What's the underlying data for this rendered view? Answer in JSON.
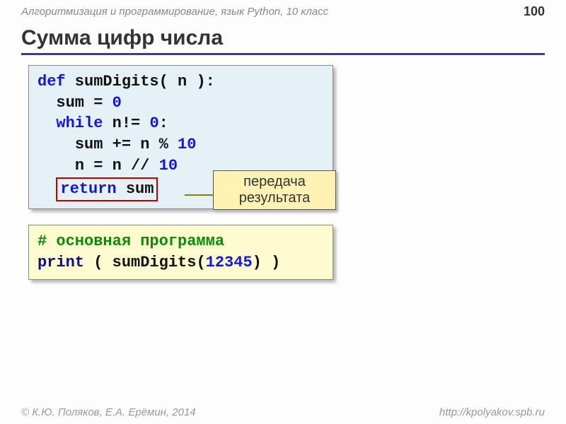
{
  "header": {
    "course": "Алгоритмизация и программирование, язык Python, 10 класс",
    "page_number": "100"
  },
  "title": "Сумма цифр числа",
  "code1": {
    "l1_def": "def",
    "l1_rest": " sumDigits( n ):",
    "l2_a": "sum = ",
    "l2_zero": "0",
    "l3_while": "while",
    "l3_rest": " n!= ",
    "l3_zero": "0",
    "l3_colon": ":",
    "l4_a": "sum += n % ",
    "l4_ten": "10",
    "l5_a": "n = n // ",
    "l5_ten": "10",
    "l6_return": "return",
    "l6_sum": " sum"
  },
  "callout": {
    "line1": "передача",
    "line2": "результата"
  },
  "code2": {
    "l1_comment": "# основная программа",
    "l2_print": "print",
    "l2_a": " ( sumDigits(",
    "l2_num": "12345",
    "l2_b": ") )"
  },
  "footer": {
    "authors": "© К.Ю. Поляков, Е.А. Ерёмин, 2014",
    "url": "http://kpolyakov.spb.ru"
  }
}
